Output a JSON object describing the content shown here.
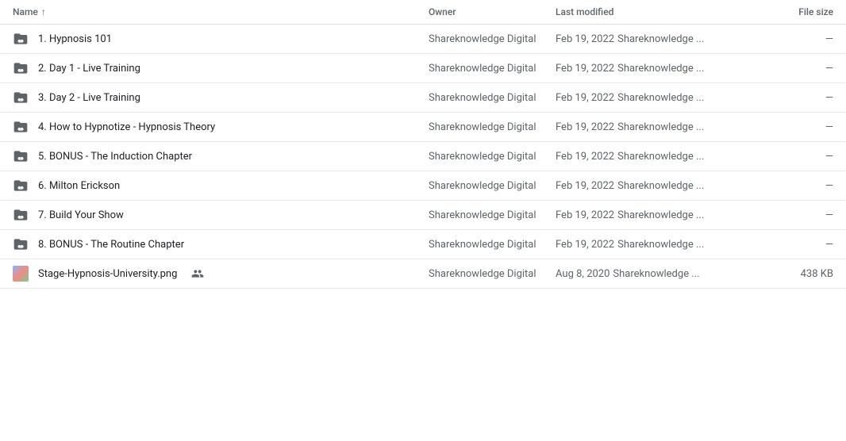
{
  "header": {
    "col_name": "Name",
    "col_owner": "Owner",
    "col_modified": "Last modified",
    "col_filesize": "File size",
    "sort_arrow": "↑"
  },
  "rows": [
    {
      "id": 1,
      "type": "folder",
      "name": "1. Hypnosis 101",
      "owner": "Shareknowledge Digital",
      "modified_date": "Feb 19, 2022",
      "modified_by": "Shareknowledge ...",
      "filesize": "—",
      "shared": false,
      "is_image": false
    },
    {
      "id": 2,
      "type": "folder",
      "name": "2. Day 1 - Live Training",
      "owner": "Shareknowledge Digital",
      "modified_date": "Feb 19, 2022",
      "modified_by": "Shareknowledge ...",
      "filesize": "—",
      "shared": false,
      "is_image": false
    },
    {
      "id": 3,
      "type": "folder",
      "name": "3. Day 2 - Live Training",
      "owner": "Shareknowledge Digital",
      "modified_date": "Feb 19, 2022",
      "modified_by": "Shareknowledge ...",
      "filesize": "—",
      "shared": false,
      "is_image": false
    },
    {
      "id": 4,
      "type": "folder",
      "name": "4. How to Hypnotize - Hypnosis Theory",
      "owner": "Shareknowledge Digital",
      "modified_date": "Feb 19, 2022",
      "modified_by": "Shareknowledge ...",
      "filesize": "—",
      "shared": false,
      "is_image": false
    },
    {
      "id": 5,
      "type": "folder",
      "name": "5. BONUS - The Induction Chapter",
      "owner": "Shareknowledge Digital",
      "modified_date": "Feb 19, 2022",
      "modified_by": "Shareknowledge ...",
      "filesize": "—",
      "shared": false,
      "is_image": false
    },
    {
      "id": 6,
      "type": "folder",
      "name": "6. Milton Erickson",
      "owner": "Shareknowledge Digital",
      "modified_date": "Feb 19, 2022",
      "modified_by": "Shareknowledge ...",
      "filesize": "—",
      "shared": false,
      "is_image": false
    },
    {
      "id": 7,
      "type": "folder",
      "name": "7. Build Your Show",
      "owner": "Shareknowledge Digital",
      "modified_date": "Feb 19, 2022",
      "modified_by": "Shareknowledge ...",
      "filesize": "—",
      "shared": false,
      "is_image": false
    },
    {
      "id": 8,
      "type": "folder",
      "name": "8. BONUS - The Routine Chapter",
      "owner": "Shareknowledge Digital",
      "modified_date": "Feb 19, 2022",
      "modified_by": "Shareknowledge ...",
      "filesize": "—",
      "shared": false,
      "is_image": false
    },
    {
      "id": 9,
      "type": "image",
      "name": "Stage-Hypnosis-University.png",
      "owner": "Shareknowledge Digital",
      "modified_date": "Aug 8, 2020",
      "modified_by": "Shareknowledge ...",
      "filesize": "438 KB",
      "shared": true,
      "is_image": true
    }
  ]
}
